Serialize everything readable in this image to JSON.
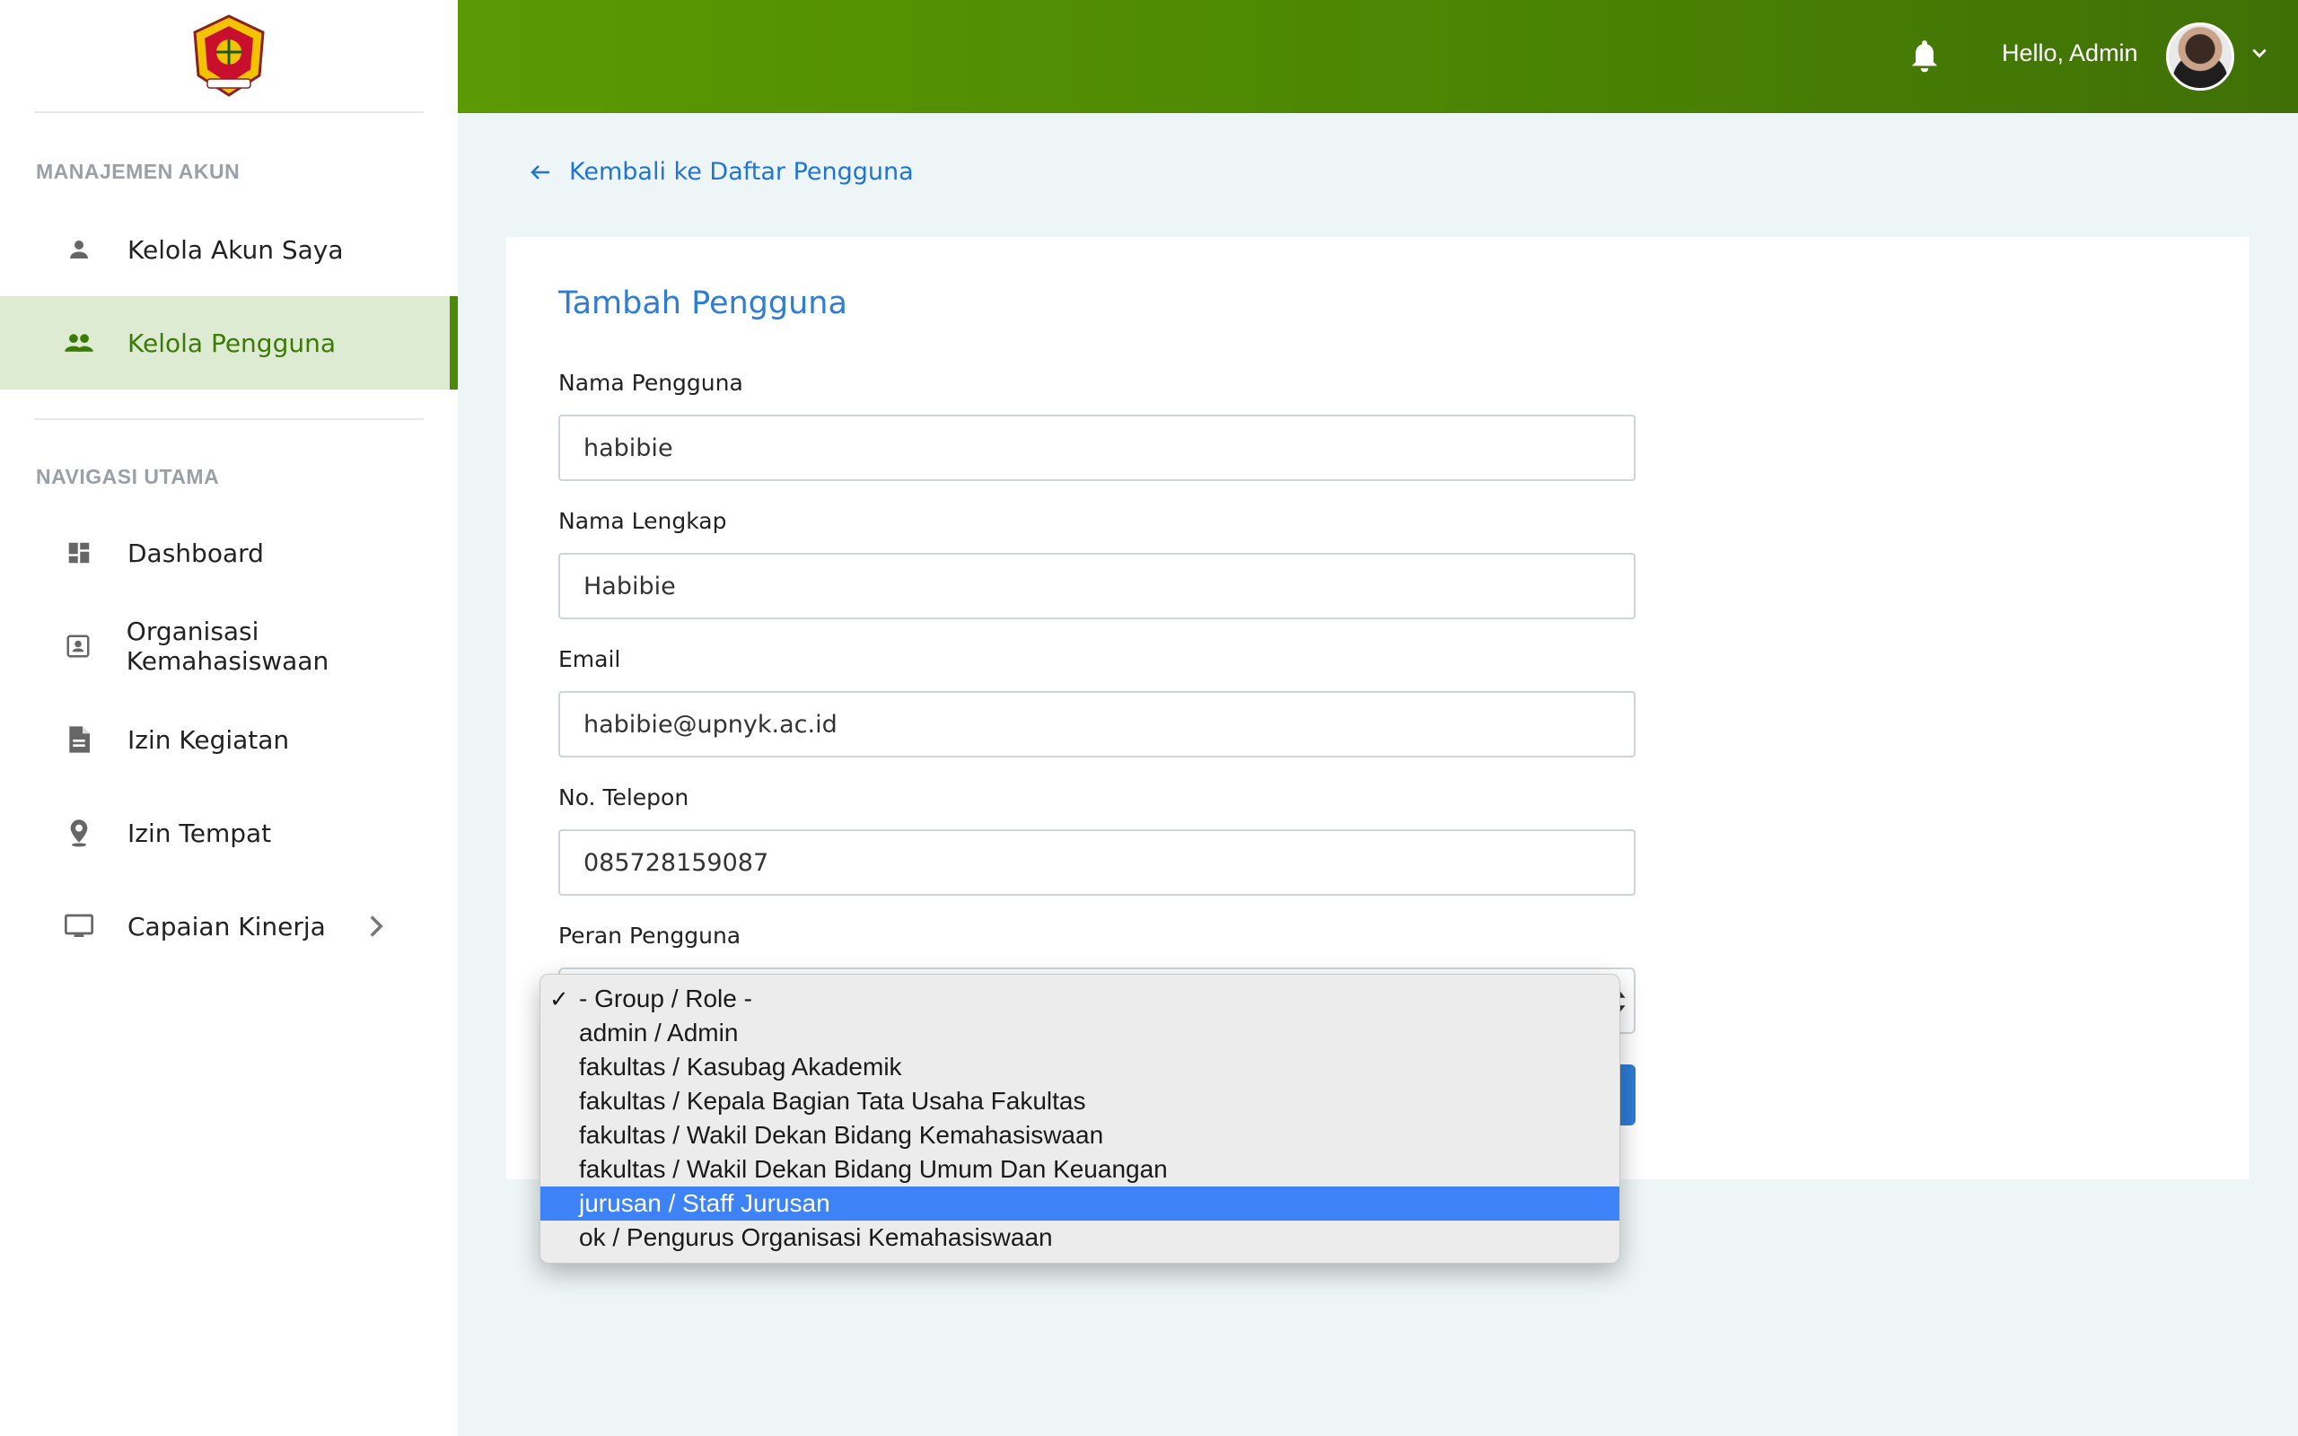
{
  "header": {
    "greeting": "Hello, Admin",
    "bell_icon": "bell-icon",
    "avatar_icon": "avatar",
    "accent_color": "#4a8303"
  },
  "sidebar": {
    "section_account": "MANAJEMEN AKUN",
    "section_nav": "NAVIGASI UTAMA",
    "items": [
      {
        "label": "Kelola Akun Saya",
        "icon": "person-icon"
      },
      {
        "label": "Kelola Pengguna",
        "icon": "people-icon",
        "active": true
      },
      {
        "label": "Dashboard",
        "icon": "dashboard-icon"
      },
      {
        "label": "Organisasi Kemahasiswaan",
        "icon": "contact-card-icon"
      },
      {
        "label": "Izin Kegiatan",
        "icon": "document-icon"
      },
      {
        "label": "Izin Tempat",
        "icon": "location-pin-icon"
      },
      {
        "label": "Capaian Kinerja",
        "icon": "monitor-icon"
      }
    ]
  },
  "main": {
    "back_link": "Kembali ke Daftar Pengguna",
    "form_title": "Tambah Pengguna",
    "fields": {
      "username_label": "Nama Pengguna",
      "username_value": "habibie",
      "fullname_label": "Nama Lengkap",
      "fullname_value": "Habibie",
      "email_label": "Email",
      "email_value": "habibie@upnyk.ac.id",
      "phone_label": "No. Telepon",
      "phone_value": "085728159087",
      "role_label": "Peran Pengguna"
    },
    "role_options": [
      "- Group / Role -",
      "admin / Admin",
      "fakultas / Kasubag Akademik",
      "fakultas / Kepala Bagian Tata Usaha Fakultas",
      "fakultas / Wakil Dekan Bidang Kemahasiswaan",
      "fakultas / Wakil Dekan Bidang Umum Dan Keuangan",
      "jurusan / Staff Jurusan",
      "ok / Pengurus Organisasi Kemahasiswaan"
    ],
    "checked_option": "- Group / Role -",
    "highlighted_option": "jurusan / Staff Jurusan",
    "check_mark": "✓",
    "selected_highlight_color": "#3d82f7"
  }
}
